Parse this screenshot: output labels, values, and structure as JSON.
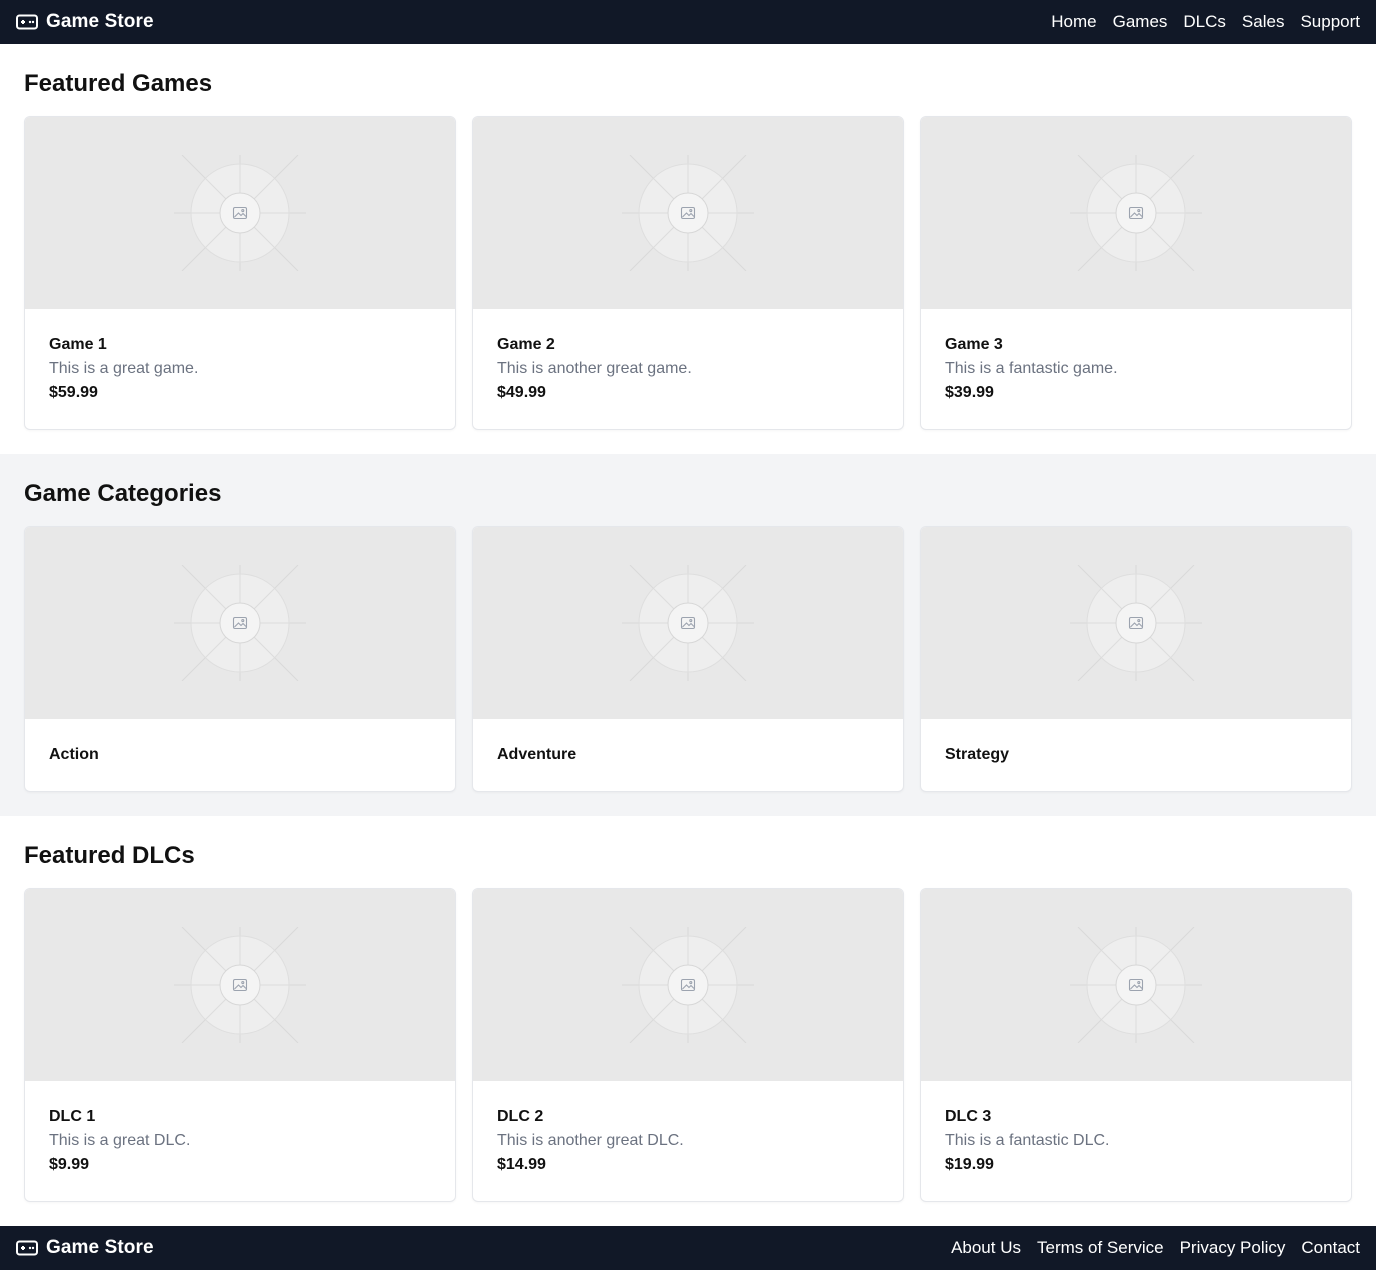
{
  "header": {
    "brand": "Game Store",
    "brand_icon": "gamepad-icon",
    "nav": [
      "Home",
      "Games",
      "DLCs",
      "Sales",
      "Support"
    ]
  },
  "featured_games": {
    "title": "Featured Games",
    "items": [
      {
        "name": "Game 1",
        "desc": "This is a great game.",
        "price": "$59.99"
      },
      {
        "name": "Game 2",
        "desc": "This is another great game.",
        "price": "$49.99"
      },
      {
        "name": "Game 3",
        "desc": "This is a fantastic game.",
        "price": "$39.99"
      }
    ]
  },
  "categories": {
    "title": "Game Categories",
    "items": [
      {
        "name": "Action"
      },
      {
        "name": "Adventure"
      },
      {
        "name": "Strategy"
      }
    ]
  },
  "featured_dlcs": {
    "title": "Featured DLCs",
    "items": [
      {
        "name": "DLC 1",
        "desc": "This is a great DLC.",
        "price": "$9.99"
      },
      {
        "name": "DLC 2",
        "desc": "This is another great DLC.",
        "price": "$14.99"
      },
      {
        "name": "DLC 3",
        "desc": "This is a fantastic DLC.",
        "price": "$19.99"
      }
    ]
  },
  "footer": {
    "brand": "Game Store",
    "links": [
      "About Us",
      "Terms of Service",
      "Privacy Policy",
      "Contact"
    ]
  },
  "colors": {
    "bar_bg": "#111827",
    "alt_section_bg": "#f3f4f6",
    "placeholder_bg": "#e8e8e8",
    "muted_text": "#6b7280"
  }
}
